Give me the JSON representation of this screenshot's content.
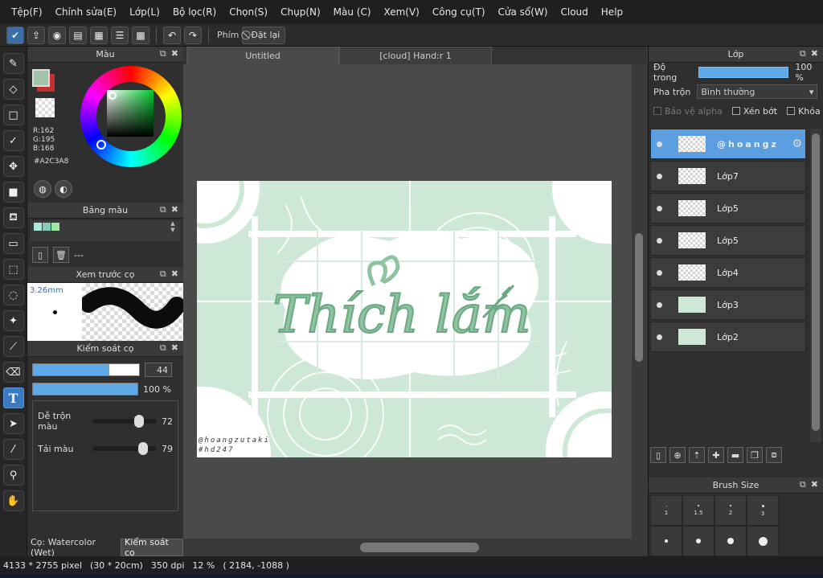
{
  "menu": [
    "Tệp(F)",
    "Chỉnh sửa(E)",
    "Lớp(L)",
    "Bộ lọc(R)",
    "Chọn(S)",
    "Chụp(N)",
    "Màu (C)",
    "Xem(V)",
    "Công cụ(T)",
    "Cửa sổ(W)",
    "Cloud",
    "Help"
  ],
  "toolbar": {
    "hotkey_label": "Phím",
    "reset_label": "Đặt lại"
  },
  "color_panel": {
    "title": "Màu",
    "r": "R:162",
    "g": "G:195",
    "b": "B:168",
    "hex": "#A2C3A8",
    "current_color": "#a2c3a8",
    "secondary_color": "#c33030"
  },
  "swatch_panel": {
    "title": "Bảng màu",
    "colors": [
      "#a8e8e0",
      "#88c8b8",
      "#9ce8a0"
    ],
    "name": "---"
  },
  "preview_panel": {
    "title": "Xem trước cọ",
    "size": "3.26mm"
  },
  "brush_control": {
    "title": "Kiểm soát cọ",
    "size": "44",
    "size_fraction": 0.72,
    "opacity": "100 %",
    "opacity_fraction": 1.0,
    "mix_label": "Dễ trộn màu",
    "mix_value": "72",
    "mix_fraction": 0.72,
    "load_label": "Tải màu",
    "load_value": "79",
    "load_fraction": 0.79
  },
  "left_tabs": {
    "brush": "Cọ: Watercolor (Wet)",
    "control": "Kiểm soát cọ"
  },
  "canvas": {
    "tabs": [
      "Untitled",
      "[cloud] Hand:r 1"
    ],
    "art_text": "Thích lắm",
    "signature_1": "@hoangzutaki",
    "signature_2": "#hd247"
  },
  "layer_panel": {
    "title": "Lớp",
    "opacity_label": "Độ trong",
    "opacity_value": "100 %",
    "blend_label": "Pha trộn",
    "blend_value": "Bình thường",
    "protect_alpha": "Bảo vệ alpha",
    "clip": "Xén bớt",
    "lock": "Khóa",
    "layers": [
      {
        "name": "@hoangz",
        "selected": true
      },
      {
        "name": "Lớp7",
        "selected": false
      },
      {
        "name": "Lớp5",
        "selected": false
      },
      {
        "name": "Lớp5",
        "selected": false
      },
      {
        "name": "Lớp4",
        "selected": false
      },
      {
        "name": "Lớp3",
        "selected": false
      },
      {
        "name": "Lớp2",
        "selected": false
      }
    ]
  },
  "brush_size_panel": {
    "title": "Brush Size",
    "sizes": [
      "1",
      "1.5",
      "2",
      "3"
    ]
  },
  "status": {
    "dimensions": "4133 * 2755 pixel",
    "physical": "(30 * 20cm)",
    "dpi": "350 dpi",
    "zoom": "12 %",
    "coords": "( 2184, -1088 )"
  }
}
